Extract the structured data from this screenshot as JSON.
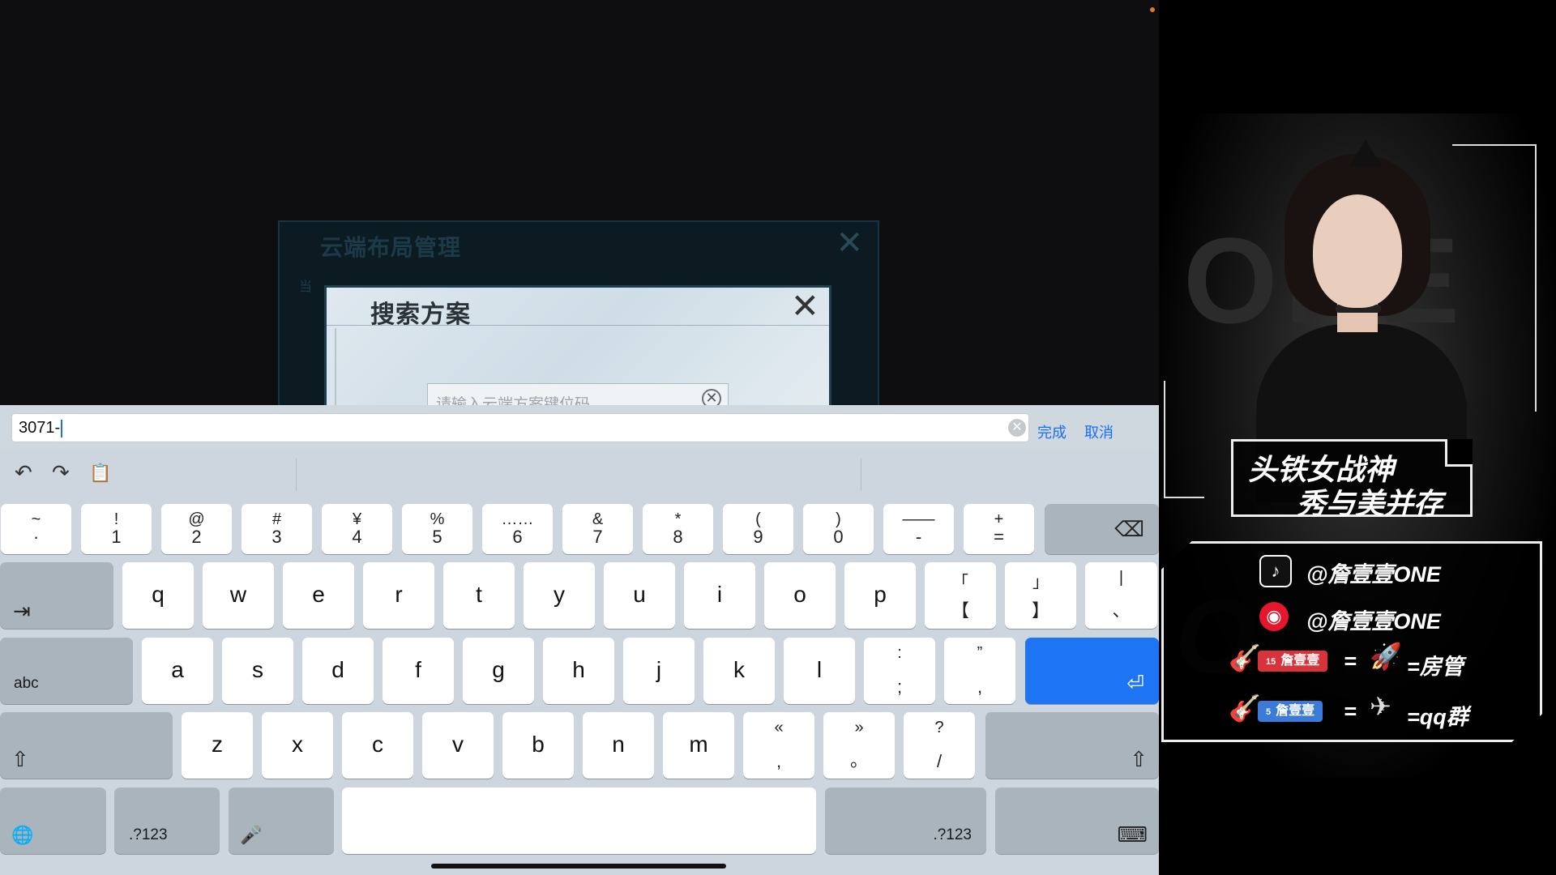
{
  "game": {
    "outer_dialog_title": "云端布局管理",
    "outer_dialog_sub": "当",
    "inner_dialog_title": "搜索方案",
    "search_placeholder": "请输入云端方案键位码",
    "close_glyph": "✕",
    "clear_glyph": "✕"
  },
  "ime_bar": {
    "value": "3071-",
    "done_label": "完成",
    "cancel_label": "取消",
    "clear_glyph": "✕"
  },
  "toolbar": {
    "undo_icon": "↶",
    "redo_icon": "↷",
    "paste_icon": "📋"
  },
  "keyboard": {
    "row1": [
      {
        "top": "~",
        "bot": "·"
      },
      {
        "top": "!",
        "bot": "1"
      },
      {
        "top": "@",
        "bot": "2"
      },
      {
        "top": "#",
        "bot": "3"
      },
      {
        "top": "¥",
        "bot": "4"
      },
      {
        "top": "%",
        "bot": "5"
      },
      {
        "top": "……",
        "bot": "6"
      },
      {
        "top": "&",
        "bot": "7"
      },
      {
        "top": "*",
        "bot": "8"
      },
      {
        "top": "(",
        "bot": "9"
      },
      {
        "top": ")",
        "bot": "0"
      },
      {
        "top": "——",
        "bot": "-"
      },
      {
        "top": "+",
        "bot": "="
      }
    ],
    "row2": [
      "q",
      "w",
      "e",
      "r",
      "t",
      "y",
      "u",
      "i",
      "o",
      "p"
    ],
    "row2_symbols": [
      {
        "top": "「",
        "bot": "【"
      },
      {
        "top": "」",
        "bot": "】"
      },
      {
        "top": "|",
        "bot": "、"
      }
    ],
    "row3": [
      "a",
      "s",
      "d",
      "f",
      "g",
      "h",
      "j",
      "k",
      "l"
    ],
    "row3_symbols": [
      {
        "top": ":",
        "bot": ";"
      },
      {
        "top": "”",
        "bot": ","
      }
    ],
    "row4": [
      "z",
      "x",
      "c",
      "v",
      "b",
      "n",
      "m"
    ],
    "row4_symbols": [
      {
        "top": "«",
        "bot": ","
      },
      {
        "top": "»",
        "bot": "。"
      },
      {
        "top": "?",
        "bot": "/"
      }
    ],
    "abc_label": "abc",
    "num_label_left": ".?123",
    "num_label_right": ".?123",
    "tab_icon": "⇥",
    "delete_icon": "⌫",
    "return_icon": "⏎",
    "shift_icon": "⇧",
    "globe_icon": "🌐",
    "mic_icon": "🎤",
    "hide_keyboard_icon": "⌨"
  },
  "overlay": {
    "watermark": "ONE",
    "title_line1": "头铁女战神",
    "title_line2": "秀与美并存",
    "tiktok_handle": "@詹壹壹ONE",
    "weibo_handle": "@詹壹壹ONE",
    "tag_red": "詹壹壹",
    "tag_red_level": "15",
    "tag_blue": "詹壹壹",
    "tag_blue_level": "5",
    "equals": "=",
    "reward1": "=房管",
    "reward2": "=qq群",
    "tiktok_icon": "♪",
    "weibo_icon": "◉",
    "guitar_icon": "🎸",
    "rocket_icon": "🚀",
    "plane_icon": "✈"
  }
}
